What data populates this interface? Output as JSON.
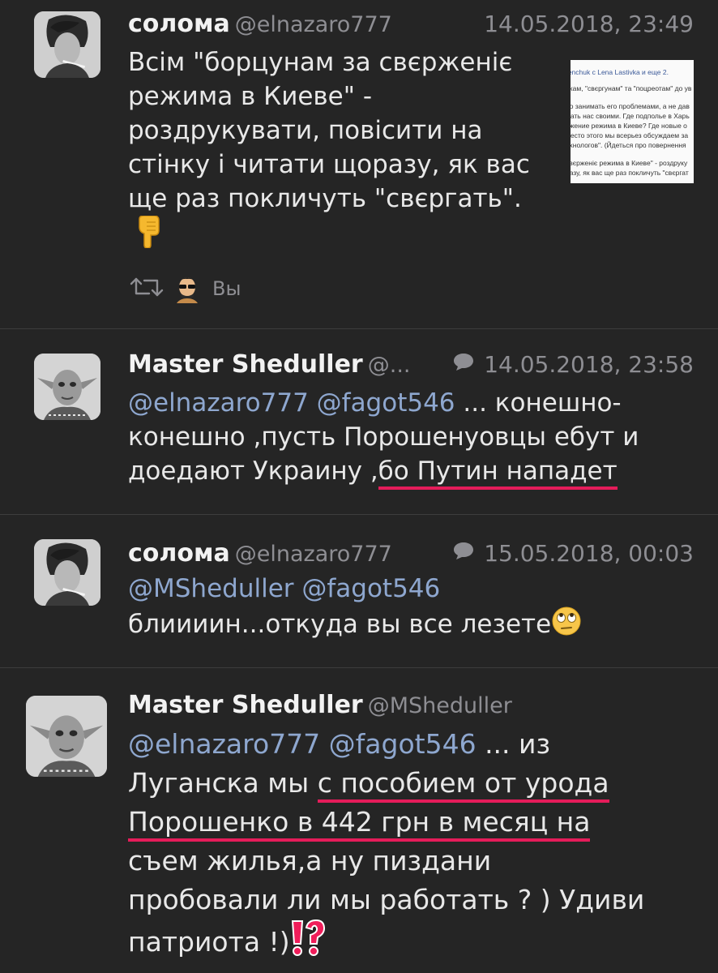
{
  "tweets": [
    {
      "name": "солома",
      "handle": "@elnazaro777",
      "time": "14.05.2018, 23:49",
      "lines": [
        "Всім \"борцунам за свєрженіє",
        "режима в Киеве\" -",
        "роздрукувати, повісити на",
        "стінку і читати щоразу, як вас",
        "ще раз покличуть \"свєргать\"."
      ],
      "attachment_lines": [
        "renchuk с Lena Lastivka и еще 2.",
        "",
        "икам, \"свєргунам\" та \"поцреотам\" до ув",
        "",
        "но занимать его проблемами, а не дав",
        "мать нас своими. Где подполье в Харь",
        "ржение режима в Киеве? Где новые о",
        "место этого мы всерьез обсуждаем за",
        "ехнологов\". (Йдеться про повернення",
        "",
        "свєрженіє режима в Киеве\" - роздруку",
        "разу, як вас ще раз покличуть \"свєргат"
      ],
      "liked_by": "Вы"
    },
    {
      "name": "Master Shedullеr",
      "handle": "@...",
      "time": "14.05.2018, 23:58",
      "mentions": "@elnazaro777 @fagot546",
      "line1_rest": " ... конешно-",
      "line2": "конешно ,пусть Порошенуовцы ебут и",
      "line3_plain": "доедают Украину ,",
      "line3_underlined": "бо Путин нападет"
    },
    {
      "name": "солома",
      "handle": "@elnazaro777",
      "time": "15.05.2018, 00:03",
      "mentions": "@MShedullеr @fagot546",
      "line2": "блиииин...откуда вы все лезете"
    },
    {
      "name": "Master Shedullеr",
      "handle": "@MShedullеr",
      "mentions": "@elnazaro777 @fagot546",
      "line1_rest": " ... из",
      "line2_plain": "Луганска мы ",
      "line2_underlined": "с пособием от урода",
      "line3_underlined": "Порошенко в 442 грн в месяц на",
      "line4": "съем жилья,а ну пиздани",
      "line5": "пробовали ли мы работать ? ) Удиви",
      "line6": "патриота !)"
    }
  ],
  "icons": {
    "retweet": "retweet-icon",
    "reply": "reply-bubble-icon",
    "point_down": "backhand-index-pointing-down-emoji",
    "eye_roll": "face-with-rolling-eyes-emoji",
    "interrobang": "exclamation-question-mark-emoji"
  },
  "colors": {
    "background": "#252525",
    "mention": "#8ea7cf",
    "underline": "#e51c5a",
    "secondary": "#8e8e93"
  }
}
